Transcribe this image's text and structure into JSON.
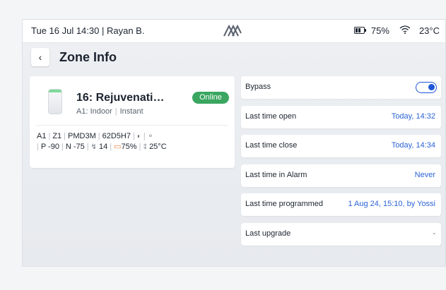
{
  "status_bar": {
    "datetime_user": "Tue 16 Jul 14:30 | Rayan B.",
    "battery_percent": "75%",
    "temperature": "23°C"
  },
  "header": {
    "title": "Zone Info"
  },
  "device": {
    "name": "16: Rejuvenati…",
    "location": "A1: Indoor",
    "mode": "Instant",
    "status": "Online",
    "specs": {
      "area": "A1",
      "zone": "Z1",
      "model": "PMD3M",
      "serial": "62D5H7",
      "p_value": "P -90",
      "n_value": "N -75",
      "signal": "14",
      "battery": "75%",
      "temperature": "25°C"
    }
  },
  "info_rows": [
    {
      "label": "Bypass",
      "value": ""
    },
    {
      "label": "Last time open",
      "value": "Today, 14:32"
    },
    {
      "label": "Last time close",
      "value": "Today, 14:34"
    },
    {
      "label": "Last time in Alarm",
      "value": "Never"
    },
    {
      "label": "Last time programmed",
      "value": "1 Aug 24, 15:10, by Yossi"
    },
    {
      "label": "Last upgrade",
      "value": "-"
    }
  ],
  "colors": {
    "accent": "#1e56d6",
    "online": "#3aa660",
    "value_text": "#2c63d6"
  },
  "icons": [
    "back-chevron-icon",
    "brand-logo-icon",
    "battery-icon",
    "wifi-icon",
    "device-sensor-icon",
    "motion-icon",
    "antenna-icon",
    "signal-bolt-icon",
    "battery-small-icon",
    "thermometer-icon"
  ]
}
